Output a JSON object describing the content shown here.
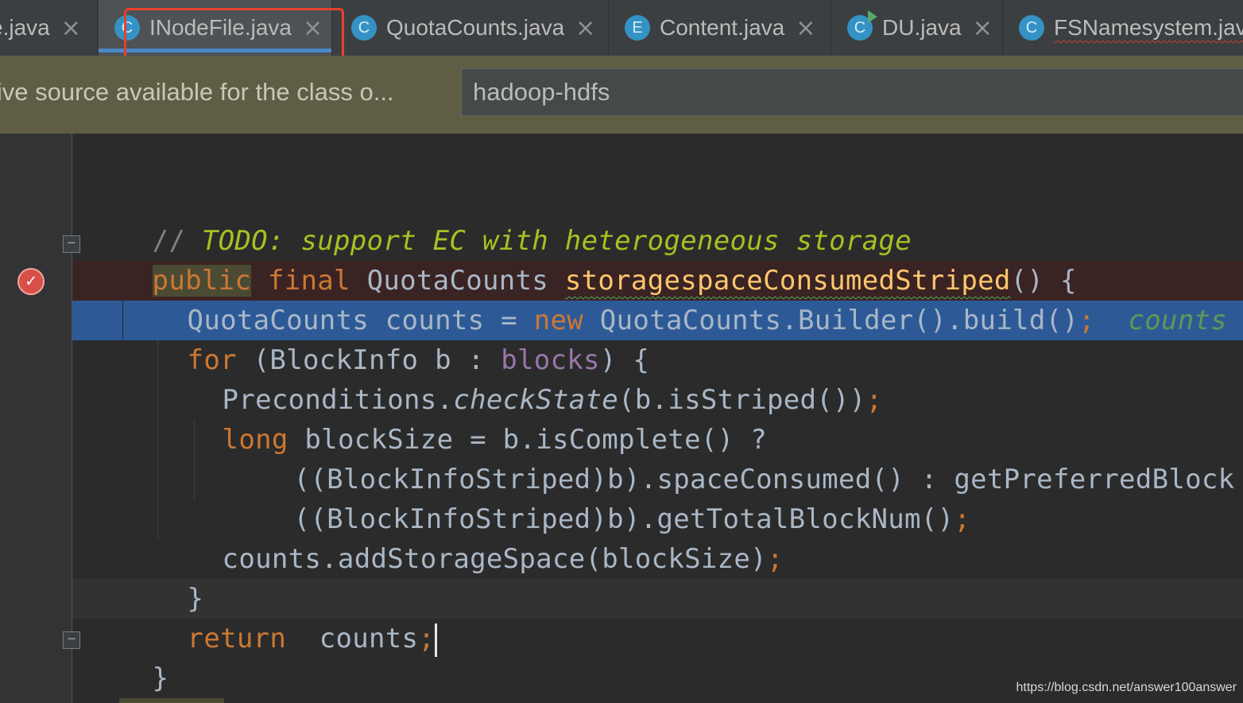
{
  "tabs": [
    {
      "label": "e.java",
      "icon": "",
      "active": false
    },
    {
      "label": "INodeFile.java",
      "icon": "C",
      "active": true
    },
    {
      "label": "QuotaCounts.java",
      "icon": "C",
      "active": false
    },
    {
      "label": "Content.java",
      "icon": "E",
      "active": false
    },
    {
      "label": "DU.java",
      "icon": "C",
      "active": false
    },
    {
      "label": "FSNamesystem.jav",
      "icon": "C",
      "active": false
    }
  ],
  "close_glyph": "×",
  "banner": {
    "message": "ative source available for the class o...",
    "selected_module": "hadoop-hdfs"
  },
  "code": {
    "l1_comment_slashes": "// ",
    "l1_todo": "TODO: support EC with heterogeneous storage",
    "l2_public": "public",
    "l2_final": "final",
    "l2_type": "QuotaCounts",
    "l2_method": "storagespaceConsumedStriped",
    "l2_tail": "() {",
    "l3_decl": "QuotaCounts counts = ",
    "l3_new": "new",
    "l3_rest": " QuotaCounts.Builder().build()",
    "l3_semi": ";",
    "l3_hint": "counts",
    "l4_for": "for",
    "l4_head": " (BlockInfo b : ",
    "l4_field": "blocks",
    "l4_tail": ") {",
    "l5_obj": "Preconditions.",
    "l5_method": "checkState",
    "l5_args": "(b.isStriped())",
    "l5_semi": ";",
    "l6_long": "long",
    "l6_rest": " blockSize = b.isComplete() ?",
    "l7": "((BlockInfoStriped)b).spaceConsumed() : getPreferredBlock",
    "l8": "((BlockInfoStriped)b).getTotalBlockNum()",
    "l8_semi": ";",
    "l9": "counts.addStorageSpace(blockSize)",
    "l9_semi": ";",
    "l10": "}",
    "l11_return": "return",
    "l11_rest": "  counts",
    "l11_semi": ";",
    "l12": "}"
  },
  "watermark": "https://blog.csdn.net/answer100answer",
  "colors": {
    "accent": "#4a88c7",
    "highlight_box": "#e8412c",
    "execution_line": "#2d5a97",
    "breakpoint": "#d84f4a"
  }
}
